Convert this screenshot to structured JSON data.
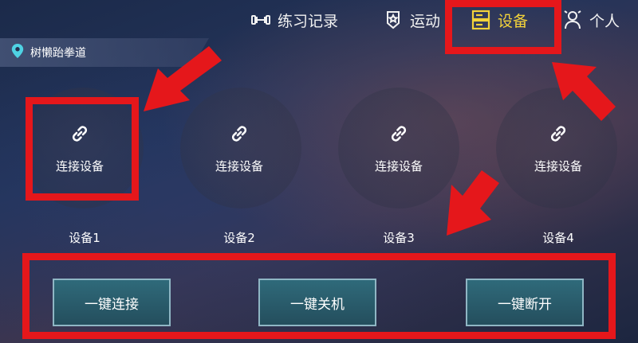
{
  "nav": {
    "items": [
      {
        "label": "练习记录",
        "icon": "dumbbell-icon"
      },
      {
        "label": "运动",
        "icon": "sport-icon"
      },
      {
        "label": "设备",
        "icon": "device-icon",
        "active": true
      },
      {
        "label": "个人",
        "icon": "person-icon"
      }
    ]
  },
  "location": {
    "name": "树懒跆拳道",
    "icon": "location-pin-icon"
  },
  "devices": [
    {
      "action_label": "连接设备",
      "name": "设备1"
    },
    {
      "action_label": "连接设备",
      "name": "设备2"
    },
    {
      "action_label": "连接设备",
      "name": "设备3"
    },
    {
      "action_label": "连接设备",
      "name": "设备4"
    }
  ],
  "actions": {
    "connect_all": "一键连接",
    "shutdown_all": "一键关机",
    "disconnect_all": "一键断开"
  },
  "colors": {
    "active_nav": "#f3d23a",
    "annotation_red": "#e5171b",
    "button_fill": "#2f6a7a",
    "button_border": "#8fb6c4"
  }
}
